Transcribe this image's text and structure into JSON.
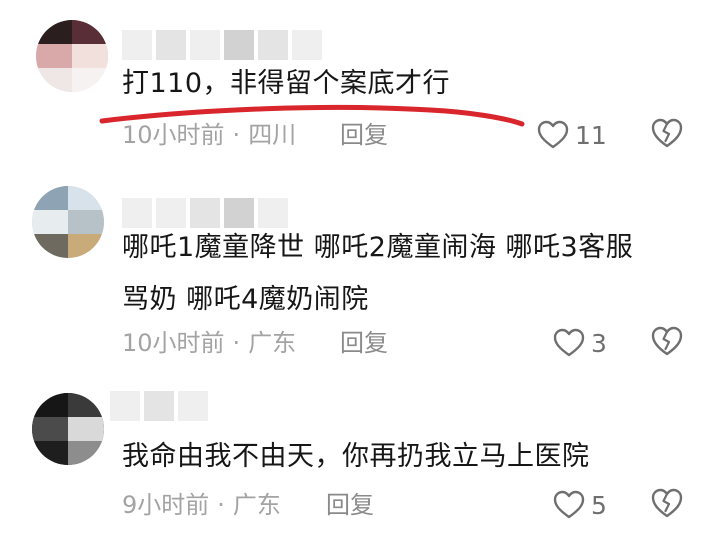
{
  "comments": [
    {
      "text": "打110，非得留个案底才行",
      "time": "10小时前",
      "location": "四川",
      "reply_label": "回复",
      "likes": "11",
      "like_icon": "heart-outline-icon",
      "dislike_icon": "broken-heart-icon",
      "annotation_color": "#d9252c"
    },
    {
      "text_line1": "哪吒1魔童降世 哪吒2魔童闹海 哪吒3客服",
      "text_line2": "骂奶 哪吒4魔奶闹院",
      "time": "10小时前",
      "location": "广东",
      "reply_label": "回复",
      "likes": "3",
      "like_icon": "heart-outline-icon",
      "dislike_icon": "broken-heart-icon"
    },
    {
      "text": "我命由我不由天，你再扔我立马上医院",
      "time": "9小时前",
      "location": "广东",
      "reply_label": "回复",
      "likes": "5",
      "like_icon": "heart-outline-icon",
      "dislike_icon": "broken-heart-icon"
    }
  ],
  "meta_separator": "·"
}
